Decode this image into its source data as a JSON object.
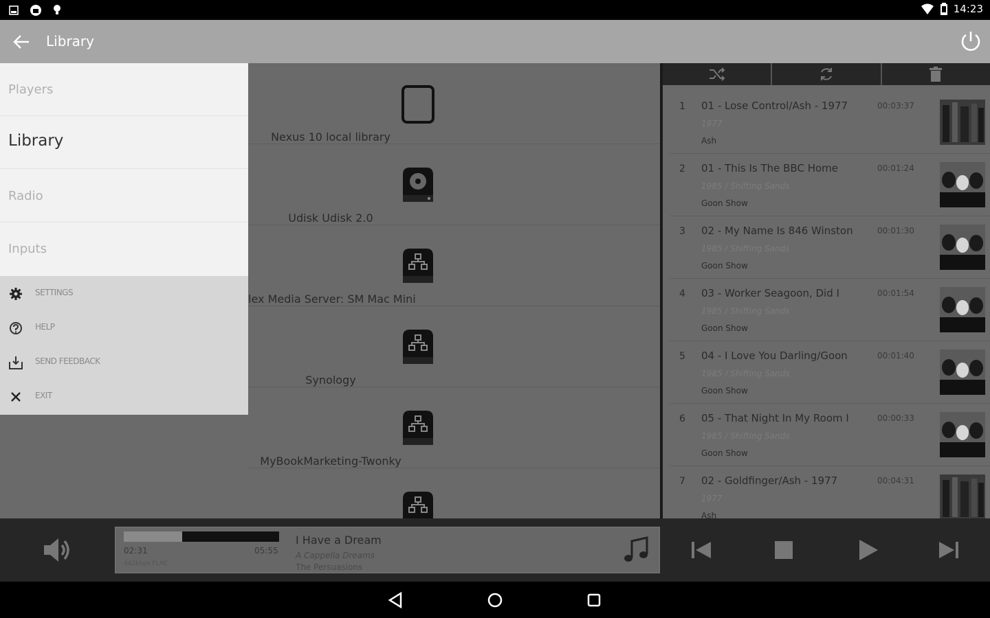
{
  "status_bar": {
    "time": "14:23"
  },
  "toolbar": {
    "title": "Library"
  },
  "drawer": {
    "nav_items": [
      {
        "label": "Players"
      },
      {
        "label": "Library"
      },
      {
        "label": "Radio"
      },
      {
        "label": "Inputs"
      }
    ],
    "active": "Library",
    "menu_items": [
      {
        "label": "SETTINGS",
        "icon": "gear-icon"
      },
      {
        "label": "HELP",
        "icon": "help-icon"
      },
      {
        "label": "SEND FEEDBACK",
        "icon": "feedback-icon"
      },
      {
        "label": "EXIT",
        "icon": "close-icon"
      }
    ]
  },
  "library": {
    "items": [
      {
        "label": "Nexus 10 local library",
        "icon": "tablet-icon"
      },
      {
        "label": "Udisk Udisk 2.0",
        "icon": "harddisk-icon"
      },
      {
        "label": "lex Media Server: SM Mac Mini",
        "icon": "network-server-icon"
      },
      {
        "label": "Synology",
        "icon": "network-server-icon"
      },
      {
        "label": "MyBookMarketing-Twonky",
        "icon": "network-server-icon"
      }
    ]
  },
  "queue": {
    "toolbar": [
      "shuffle-icon",
      "repeat-icon",
      "trash-icon"
    ],
    "tracks": [
      {
        "num": "1",
        "title": "01 - Lose Control/Ash - 1977",
        "sub": "1977",
        "artist": "Ash",
        "duration": "00:03:37",
        "art": "ash"
      },
      {
        "num": "2",
        "title": "01 - This Is The BBC Home",
        "sub": "1985 / Shifting Sands",
        "artist": "Goon Show",
        "duration": "00:01:24",
        "art": "goon"
      },
      {
        "num": "3",
        "title": "02 - My Name Is 846 Winston",
        "sub": "1985 / Shifting Sands",
        "artist": "Goon Show",
        "duration": "00:01:30",
        "art": "goon"
      },
      {
        "num": "4",
        "title": "03 - Worker Seagoon, Did I",
        "sub": "1985 / Shifting Sands",
        "artist": "Goon Show",
        "duration": "00:01:54",
        "art": "goon"
      },
      {
        "num": "5",
        "title": "04 - I Love You Darling/Goon",
        "sub": "1985 / Shifting Sands",
        "artist": "Goon Show",
        "duration": "00:01:40",
        "art": "goon"
      },
      {
        "num": "6",
        "title": "05 - That Night In My Room I",
        "sub": "1985 / Shifting Sands",
        "artist": "Goon Show",
        "duration": "00:00:33",
        "art": "goon"
      },
      {
        "num": "7",
        "title": "02 - Goldfinger/Ash - 1977",
        "sub": "1977",
        "artist": "Ash",
        "duration": "00:04:31",
        "art": "ash"
      }
    ]
  },
  "now_playing": {
    "elapsed": "02:31",
    "total": "05:55",
    "progress": 0.378,
    "format": "442kbps FLAC",
    "song": "I Have a Dream",
    "album": "A Cappella Dreams",
    "artist": "The Persuasions"
  },
  "colors": {
    "toolbar": "#a6a6a6",
    "drawer_nav": "#f2f2f2",
    "drawer_menu": "#d6d6d6",
    "player": "#262626",
    "content": "#6a6a6a"
  }
}
